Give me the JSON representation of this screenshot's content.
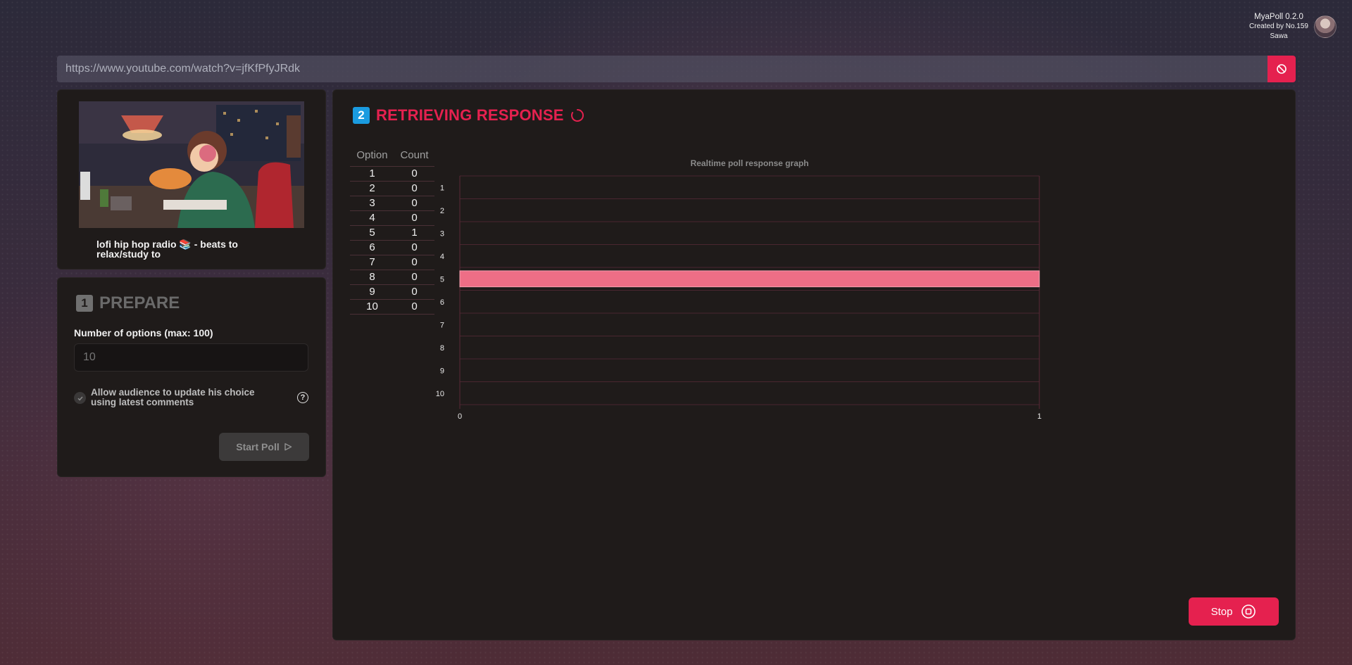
{
  "app": {
    "name": "MyaPoll 0.2.0",
    "created_by": "Created by No.159",
    "author": "Sawa"
  },
  "url_bar": {
    "value": "https://www.youtube.com/watch?v=jfKfPfyJRdk"
  },
  "video": {
    "title": "lofi hip hop radio 📚 - beats to relax/study to"
  },
  "prepare": {
    "step": "1",
    "title": "PREPARE",
    "options_label": "Number of options (max: 100)",
    "options_placeholder": "10",
    "allow_update_label": "Allow audience to update his choice using latest comments",
    "help_icon": "?",
    "start_label": "Start Poll"
  },
  "response": {
    "step": "2",
    "title": "RETRIEVING RESPONSE",
    "table_headers": {
      "option": "Option",
      "count": "Count"
    },
    "rows": [
      {
        "option": "1",
        "count": "0"
      },
      {
        "option": "2",
        "count": "0"
      },
      {
        "option": "3",
        "count": "0"
      },
      {
        "option": "4",
        "count": "0"
      },
      {
        "option": "5",
        "count": "1"
      },
      {
        "option": "6",
        "count": "0"
      },
      {
        "option": "7",
        "count": "0"
      },
      {
        "option": "8",
        "count": "0"
      },
      {
        "option": "9",
        "count": "0"
      },
      {
        "option": "10",
        "count": "0"
      }
    ],
    "stop_label": "Stop"
  },
  "colors": {
    "accent": "#e5214f",
    "bar": "#ee6e86",
    "step_blue": "#1a9be0"
  },
  "chart_data": {
    "type": "bar",
    "orientation": "horizontal",
    "title": "Realtime poll response graph",
    "categories": [
      "1",
      "2",
      "3",
      "4",
      "5",
      "6",
      "7",
      "8",
      "9",
      "10"
    ],
    "values": [
      0,
      0,
      0,
      0,
      1,
      0,
      0,
      0,
      0,
      0
    ],
    "xlim": [
      0,
      1
    ],
    "xticks": [
      "0",
      "1"
    ],
    "grid": true
  }
}
